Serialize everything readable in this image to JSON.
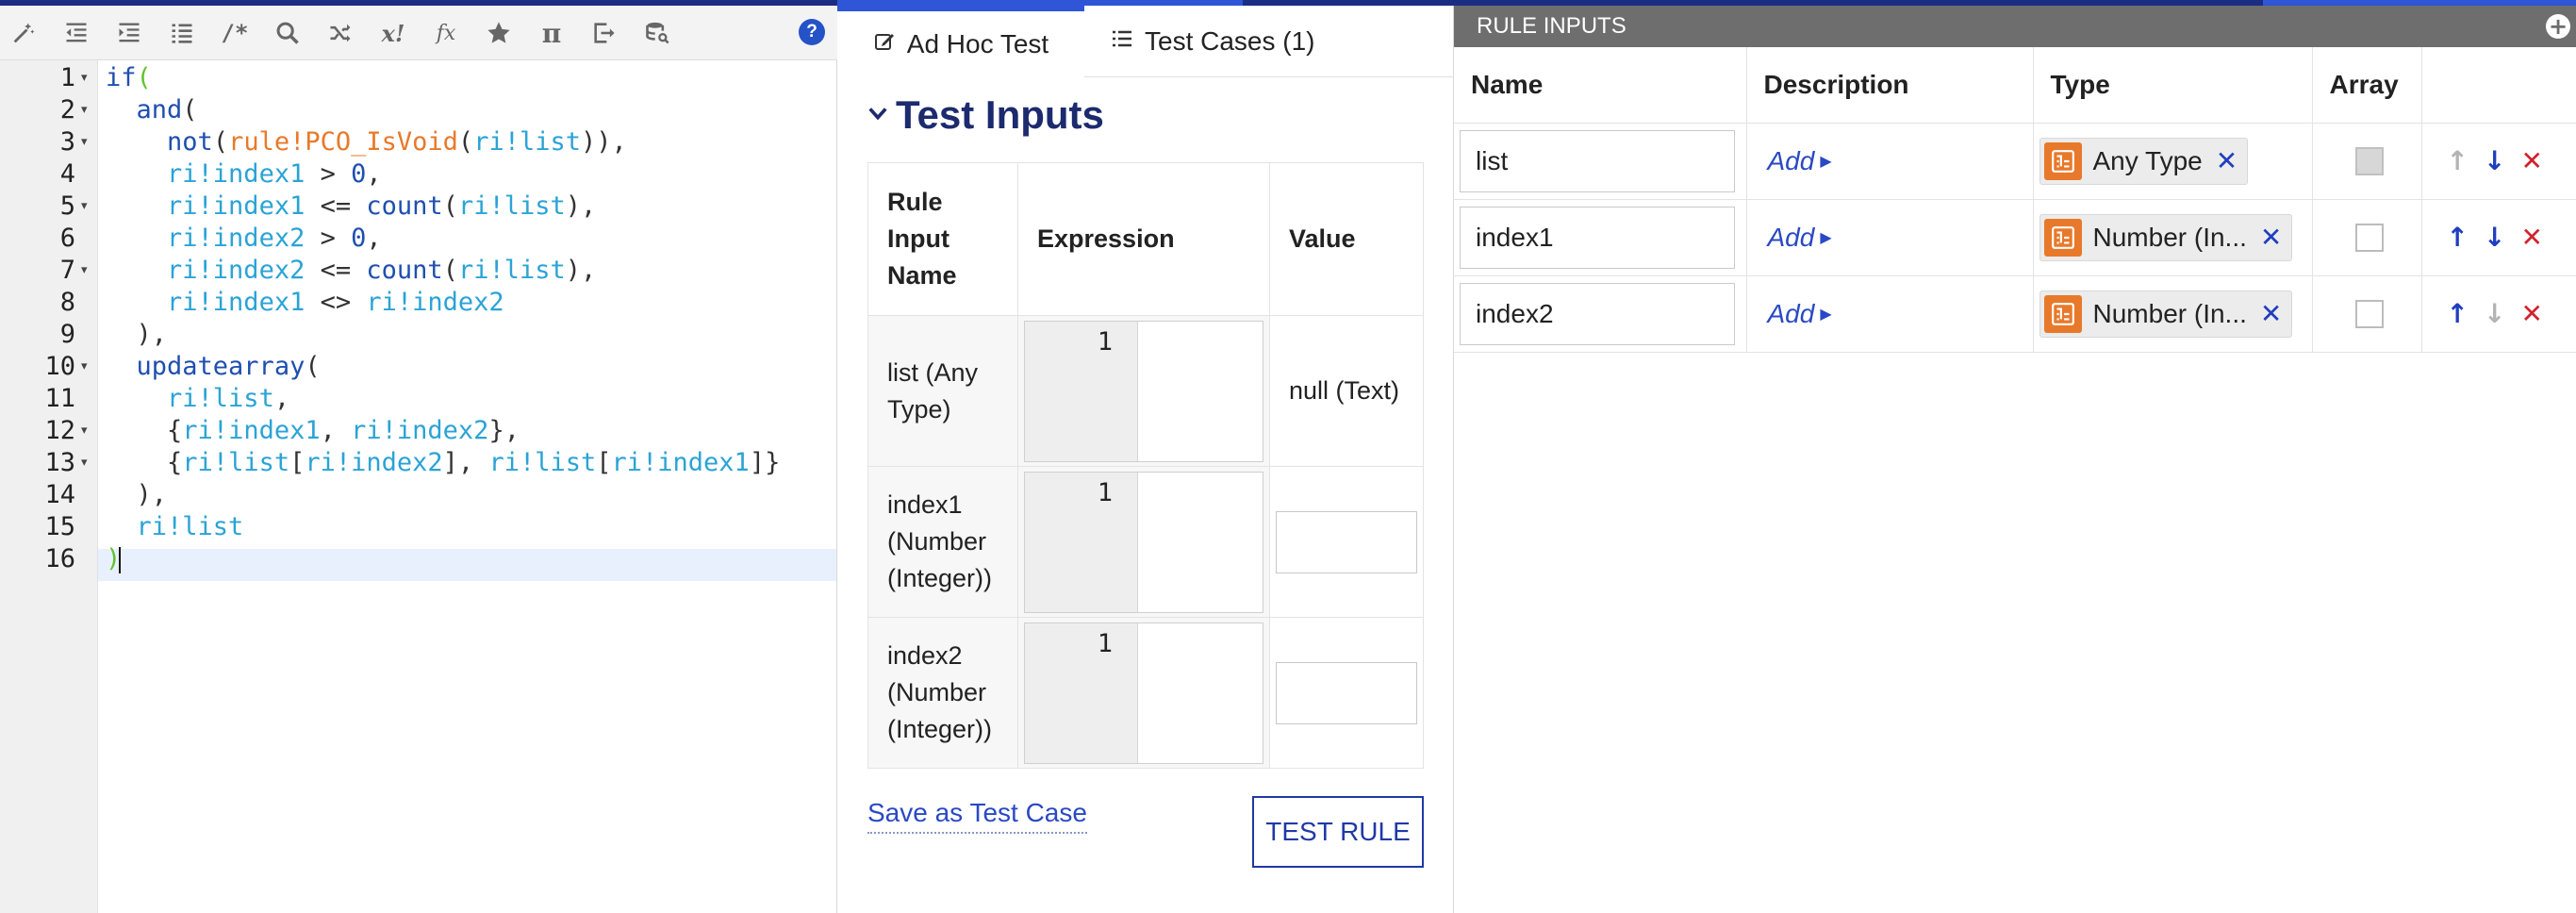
{
  "colors": {
    "accent": "#2f56d6",
    "brand_dark": "#1b2d83",
    "keyword": "#1f4fb0",
    "rule_ref": "#e8792a",
    "rule_input": "#2ba3d6",
    "delete": "#d3212c",
    "link": "#2a49c4"
  },
  "editor": {
    "toolbar": [
      {
        "name": "magic-wand-icon"
      },
      {
        "name": "outdent-icon"
      },
      {
        "name": "indent-icon"
      },
      {
        "name": "format-list-icon"
      },
      {
        "name": "comment-icon",
        "text": "/*"
      },
      {
        "name": "search-icon"
      },
      {
        "name": "shuffle-icon"
      },
      {
        "name": "factorial-icon",
        "text": "x!"
      },
      {
        "name": "function-icon",
        "text": "fx"
      },
      {
        "name": "star-icon"
      },
      {
        "name": "pi-icon",
        "text": "π"
      },
      {
        "name": "export-icon"
      },
      {
        "name": "database-search-icon"
      }
    ],
    "help_label": "?",
    "line_numbers": [
      "1",
      "2",
      "3",
      "4",
      "5",
      "6",
      "7",
      "8",
      "9",
      "10",
      "11",
      "12",
      "13",
      "14",
      "15",
      "16"
    ],
    "fold_markers": [
      "▾",
      "▾",
      "▾",
      "",
      "▾",
      "",
      "▾",
      "",
      "",
      "▾",
      "",
      "▾",
      "▾",
      "",
      "",
      ""
    ],
    "code_lines": [
      "if(",
      "  and(",
      "    not(rule!PCO_IsVoid(ri!list)),",
      "    ri!index1 > 0,",
      "    ri!index1 <= count(ri!list),",
      "    ri!index2 > 0,",
      "    ri!index2 <= count(ri!list),",
      "    ri!index1 <> ri!index2",
      "  ),",
      "  updatearray(",
      "    ri!list,",
      "    {ri!index1, ri!index2},",
      "    {ri!list[ri!index2], ri!list[ri!index1]}",
      "  ),",
      "  ri!list",
      ")"
    ]
  },
  "test_panel": {
    "tabs": [
      {
        "label": "Ad Hoc Test",
        "icon": "edit-icon",
        "active": true
      },
      {
        "label": "Test Cases (1)",
        "icon": "list-icon",
        "active": false
      }
    ],
    "section_title": "Test Inputs",
    "table": {
      "headers": [
        "Rule Input Name",
        "Expression",
        "Value"
      ],
      "rows": [
        {
          "name": "list (Any Type)",
          "expr_line": "1",
          "value": "null (Text)"
        },
        {
          "name": "index1 (Number (Integer))",
          "expr_line": "1",
          "value": ""
        },
        {
          "name": "index2 (Number (Integer))",
          "expr_line": "1",
          "value": ""
        }
      ]
    },
    "save_link": "Save as Test Case",
    "test_button": "TEST RULE"
  },
  "rule_inputs": {
    "title": "RULE INPUTS",
    "headers": [
      "Name",
      "Description",
      "Type",
      "Array"
    ],
    "rows": [
      {
        "name": "list",
        "description_link": "Add",
        "type": "Any Type",
        "array_checked": false,
        "array_disabled": true,
        "up_enabled": false,
        "down_enabled": true
      },
      {
        "name": "index1",
        "description_link": "Add",
        "type": "Number (In...",
        "array_checked": false,
        "array_disabled": false,
        "up_enabled": true,
        "down_enabled": true
      },
      {
        "name": "index2",
        "description_link": "Add",
        "type": "Number (In...",
        "array_checked": false,
        "array_disabled": false,
        "up_enabled": true,
        "down_enabled": false
      }
    ]
  }
}
